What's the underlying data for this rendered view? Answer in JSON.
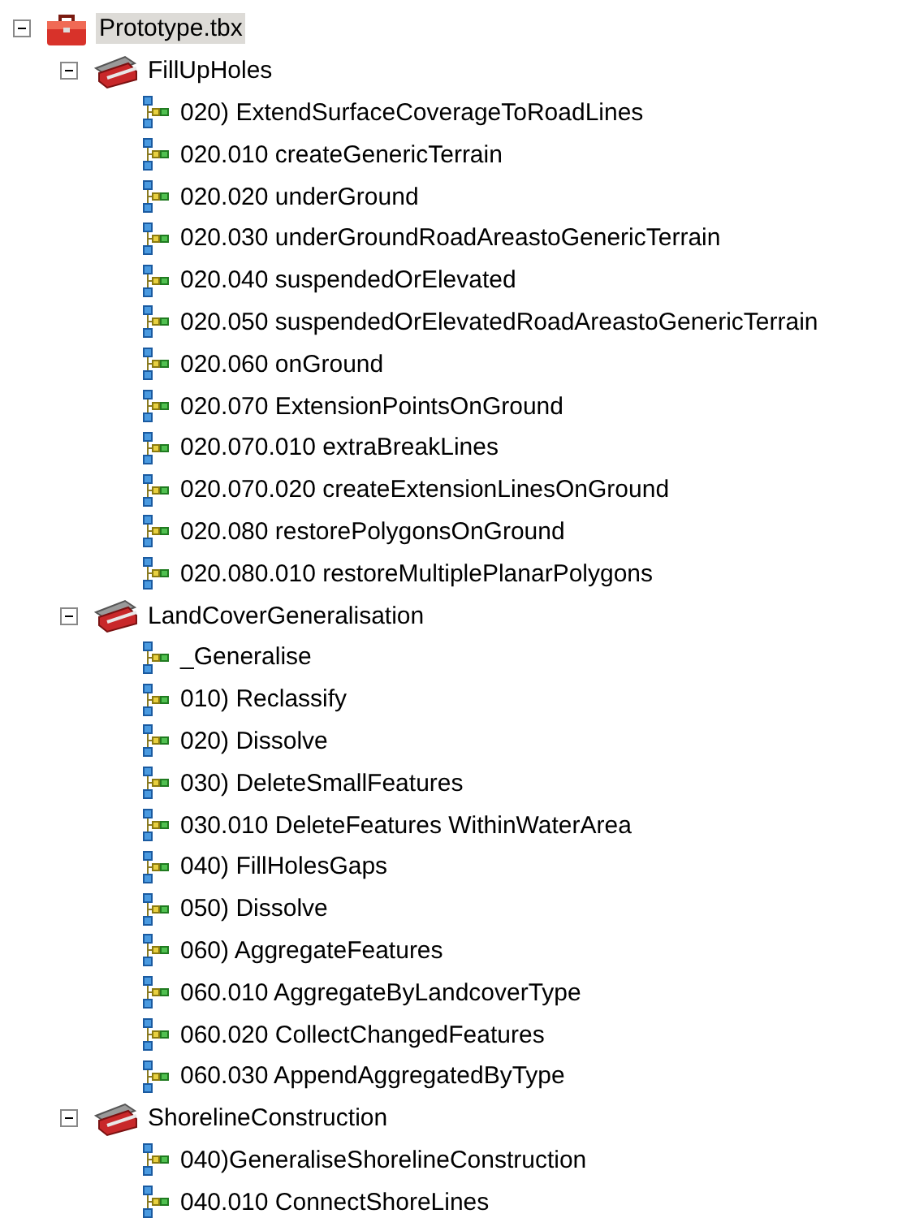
{
  "tree": {
    "label": "Prototype.tbx",
    "selected": true,
    "expanded": true,
    "children": [
      {
        "label": "FillUpHoles",
        "selected": false,
        "expanded": true,
        "children": [
          {
            "label": "020) ExtendSurfaceCoverageToRoadLines",
            "selected": false
          },
          {
            "label": "020.010 createGenericTerrain",
            "selected": false
          },
          {
            "label": "020.020 underGround",
            "selected": false
          },
          {
            "label": "020.030 underGroundRoadAreastoGenericTerrain",
            "selected": false
          },
          {
            "label": "020.040 suspendedOrElevated",
            "selected": false
          },
          {
            "label": "020.050 suspendedOrElevatedRoadAreastoGenericTerrain",
            "selected": false
          },
          {
            "label": "020.060 onGround",
            "selected": false
          },
          {
            "label": "020.070 ExtensionPointsOnGround",
            "selected": false
          },
          {
            "label": "020.070.010 extraBreakLines",
            "selected": false
          },
          {
            "label": "020.070.020 createExtensionLinesOnGround",
            "selected": false
          },
          {
            "label": "020.080 restorePolygonsOnGround",
            "selected": false
          },
          {
            "label": "020.080.010 restoreMultiplePlanarPolygons",
            "selected": false
          }
        ]
      },
      {
        "label": "LandCoverGeneralisation",
        "selected": false,
        "expanded": true,
        "children": [
          {
            "label": "_Generalise",
            "selected": false
          },
          {
            "label": "010) Reclassify",
            "selected": false
          },
          {
            "label": "020) Dissolve",
            "selected": false
          },
          {
            "label": "030) DeleteSmallFeatures",
            "selected": false
          },
          {
            "label": "030.010 DeleteFeatures WithinWaterArea",
            "selected": false
          },
          {
            "label": "040) FillHolesGaps",
            "selected": false
          },
          {
            "label": "050) Dissolve",
            "selected": false
          },
          {
            "label": "060) AggregateFeatures",
            "selected": false
          },
          {
            "label": "060.010 AggregateByLandcoverType",
            "selected": false
          },
          {
            "label": "060.020 CollectChangedFeatures",
            "selected": false
          },
          {
            "label": "060.030 AppendAggregatedByType",
            "selected": false
          }
        ]
      },
      {
        "label": "ShorelineConstruction",
        "selected": false,
        "expanded": true,
        "children": [
          {
            "label": "040)GeneraliseShorelineConstruction",
            "selected": false
          },
          {
            "label": "040.010 ConnectShoreLines",
            "selected": false
          }
        ]
      }
    ]
  }
}
